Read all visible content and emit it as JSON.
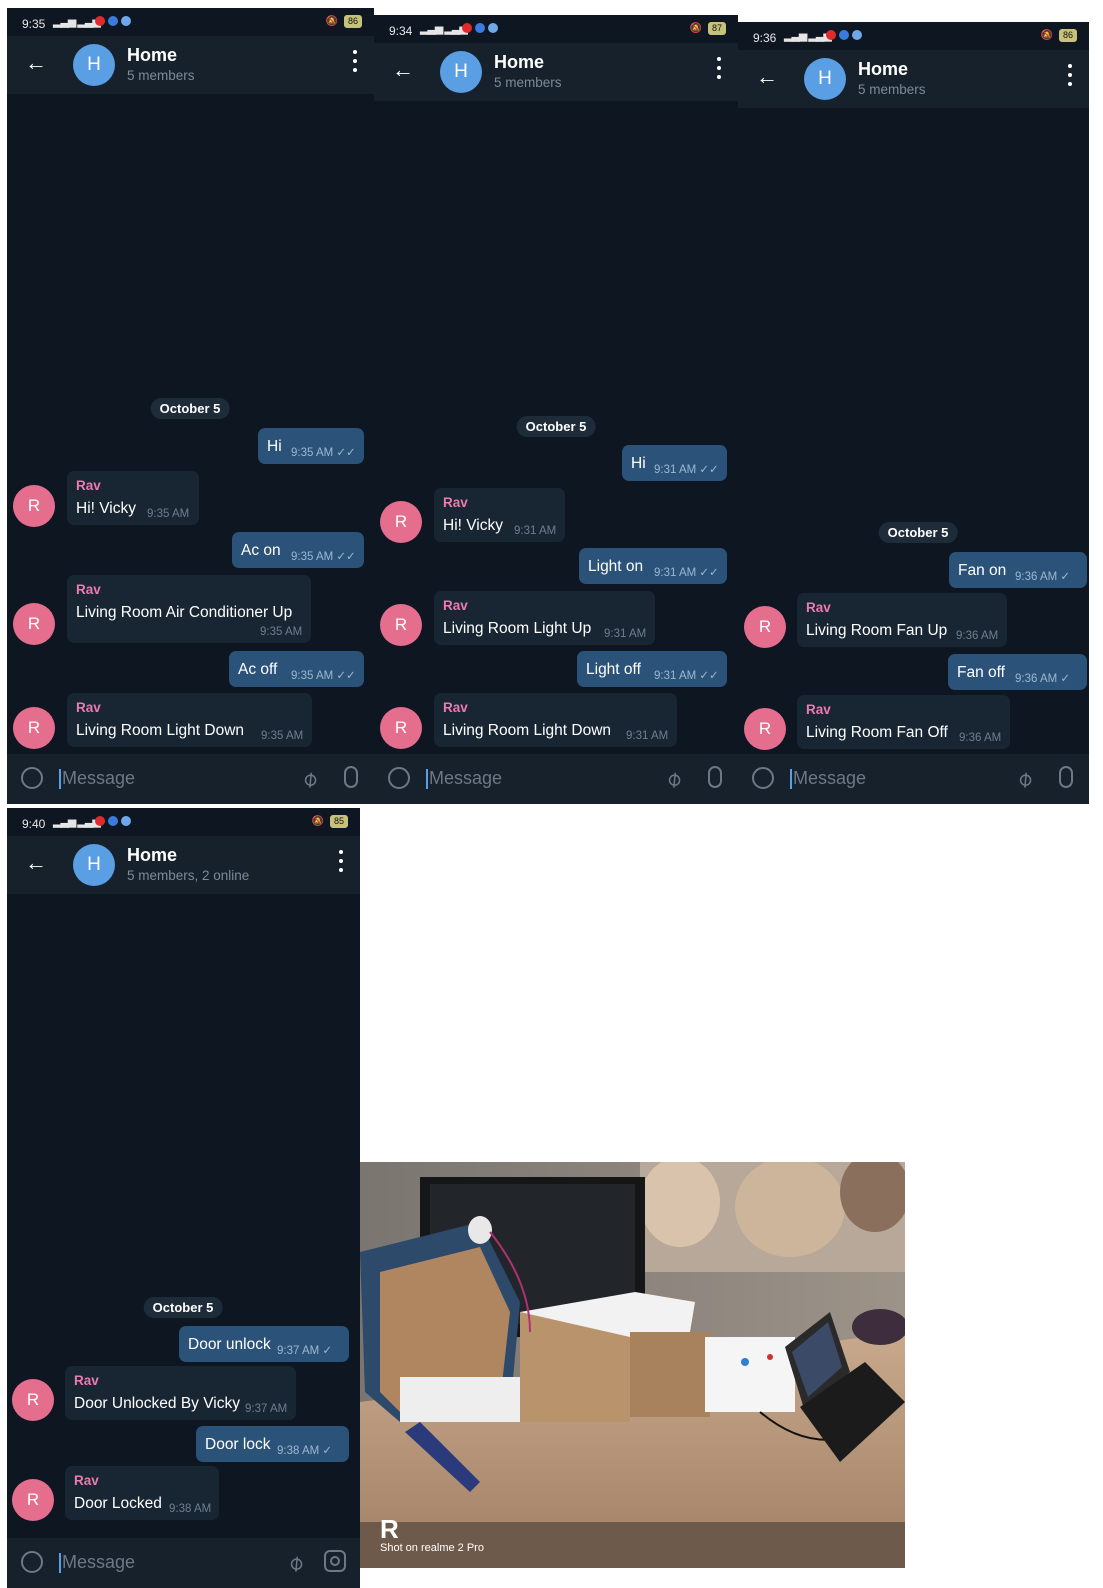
{
  "screens": [
    {
      "status_time": "9:35",
      "battery": "86",
      "header": {
        "title": "Home",
        "avatar_letter": "H",
        "subtitle": "5 members"
      },
      "date_chip": "October 5",
      "messages": [
        {
          "dir": "out",
          "text": "Hi",
          "time": "9:35 AM",
          "ticks": "✓✓"
        },
        {
          "dir": "in",
          "sender": "Rav",
          "avatar_letter": "R",
          "text": "Hi! Vicky",
          "time": "9:35 AM"
        },
        {
          "dir": "out",
          "text": "Ac on",
          "time": "9:35 AM",
          "ticks": "✓✓"
        },
        {
          "dir": "in",
          "sender": "Rav",
          "avatar_letter": "R",
          "text": "Living Room Air Conditioner Up",
          "time": "9:35 AM"
        },
        {
          "dir": "out",
          "text": "Ac off",
          "time": "9:35 AM",
          "ticks": "✓✓"
        },
        {
          "dir": "in",
          "sender": "Rav",
          "avatar_letter": "R",
          "text": "Living Room Light Down",
          "time": "9:35 AM"
        }
      ],
      "composer_placeholder": "Message"
    },
    {
      "status_time": "9:34",
      "battery": "87",
      "header": {
        "title": "Home",
        "avatar_letter": "H",
        "subtitle": "5 members"
      },
      "date_chip": "October 5",
      "messages": [
        {
          "dir": "out",
          "text": "Hi",
          "time": "9:31 AM",
          "ticks": "✓✓"
        },
        {
          "dir": "in",
          "sender": "Rav",
          "avatar_letter": "R",
          "text": "Hi! Vicky",
          "time": "9:31 AM"
        },
        {
          "dir": "out",
          "text": "Light on",
          "time": "9:31 AM",
          "ticks": "✓✓"
        },
        {
          "dir": "in",
          "sender": "Rav",
          "avatar_letter": "R",
          "text": "Living Room Light Up",
          "time": "9:31 AM"
        },
        {
          "dir": "out",
          "text": "Light off",
          "time": "9:31 AM",
          "ticks": "✓✓"
        },
        {
          "dir": "in",
          "sender": "Rav",
          "avatar_letter": "R",
          "text": "Living Room Light Down",
          "time": "9:31 AM"
        }
      ],
      "composer_placeholder": "Message"
    },
    {
      "status_time": "9:36",
      "battery": "86",
      "header": {
        "title": "Home",
        "avatar_letter": "H",
        "subtitle": "5 members"
      },
      "date_chip": "October 5",
      "messages": [
        {
          "dir": "out",
          "text": "Fan on",
          "time": "9:36 AM",
          "ticks": "✓"
        },
        {
          "dir": "in",
          "sender": "Rav",
          "avatar_letter": "R",
          "text": "Living Room Fan Up",
          "time": "9:36 AM"
        },
        {
          "dir": "out",
          "text": "Fan off",
          "time": "9:36 AM",
          "ticks": "✓"
        },
        {
          "dir": "in",
          "sender": "Rav",
          "avatar_letter": "R",
          "text": "Living Room Fan Off",
          "time": "9:36 AM"
        }
      ],
      "composer_placeholder": "Message"
    },
    {
      "status_time": "9:40",
      "battery": "85",
      "header": {
        "title": "Home",
        "avatar_letter": "H",
        "subtitle": "5 members, 2 online"
      },
      "date_chip": "October 5",
      "messages": [
        {
          "dir": "out",
          "text": "Door unlock",
          "time": "9:37 AM",
          "ticks": "✓"
        },
        {
          "dir": "in",
          "sender": "Rav",
          "avatar_letter": "R",
          "text": "Door Unlocked By Vicky",
          "time": "9:37 AM"
        },
        {
          "dir": "out",
          "text": "Door lock",
          "time": "9:38 AM",
          "ticks": "✓"
        },
        {
          "dir": "in",
          "sender": "Rav",
          "avatar_letter": "R",
          "text": "Door Locked",
          "time": "9:38 AM"
        }
      ],
      "composer_placeholder": "Message"
    }
  ],
  "photo": {
    "watermark_text": "Shot on realme 2 Pro"
  },
  "colors": {
    "chat_bg": "#0e1621",
    "header_bg": "#17212b",
    "outgoing_bubble": "#2b5278",
    "incoming_bubble": "#182533",
    "sender_name": "#ee7aae",
    "group_avatar": "#5a9ee3",
    "user_avatar": "#e56e8e"
  }
}
